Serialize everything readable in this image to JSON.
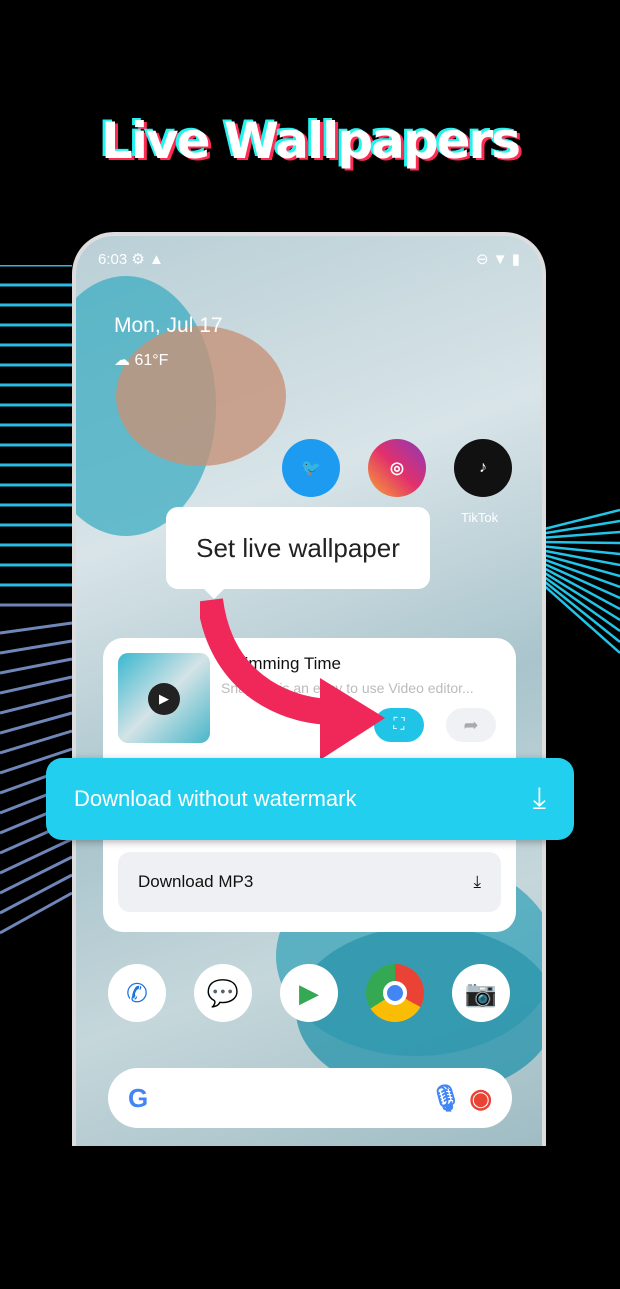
{
  "header": {
    "title": "Live Wallpapers"
  },
  "status_bar": {
    "time": "6:03"
  },
  "widget": {
    "date": "Mon, Jul 17",
    "temperature": "61°F"
  },
  "apps": [
    {
      "name": "Twitter",
      "color": "#1d9bf0"
    },
    {
      "name": "Instagram",
      "color": "#e1306c"
    },
    {
      "name": "TikTok",
      "label": "TikTok",
      "color": "#111111"
    }
  ],
  "tooltip": {
    "text": "Set live wallpaper"
  },
  "card": {
    "title": "Swimming Time",
    "description": "SnapCut is an easy to use Video editor...",
    "download_mp3": "Download MP3"
  },
  "download_button": {
    "label": "Download without watermark",
    "color": "#22cfee"
  },
  "arrow_color": "#f0285a",
  "dock": [
    "Phone",
    "Messages",
    "Play Store",
    "Chrome",
    "Camera"
  ],
  "search": {
    "logo": "G"
  }
}
